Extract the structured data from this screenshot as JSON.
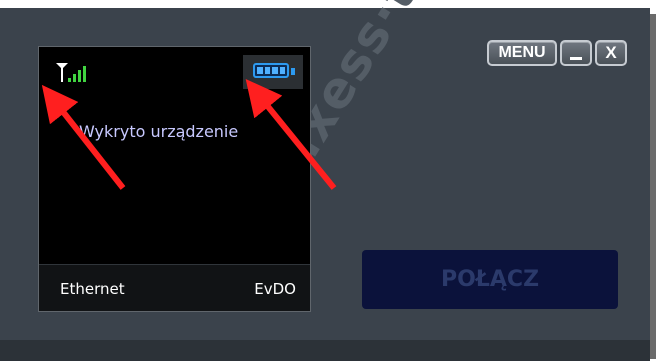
{
  "window": {
    "watermark": "axess·tel",
    "menu_label": "MENU",
    "close_label": "X"
  },
  "screen": {
    "status_message": "Wykryto urządzenie",
    "connection_label": "Ethernet",
    "network_label": "EvDO",
    "battery_level": 1.0
  },
  "connect_button": {
    "label": "POŁĄCZ"
  },
  "colors": {
    "frame": "#3b434c",
    "arrow": "#ff1f1f",
    "battery": "#2d9af0",
    "signal_antenna": "#ffffff",
    "signal_bars": "#41d441"
  }
}
